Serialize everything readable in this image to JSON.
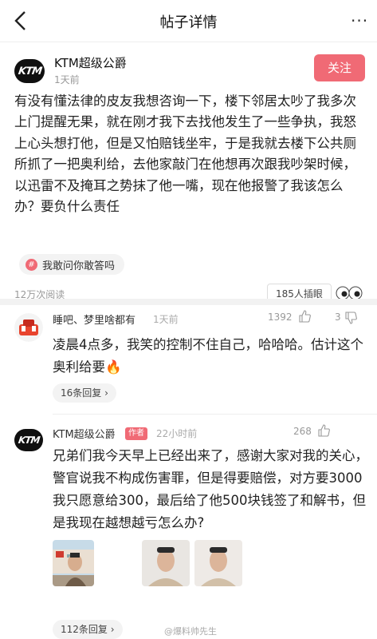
{
  "header": {
    "title": "帖子详情",
    "more_label": "···"
  },
  "post": {
    "author": "KTM超级公爵",
    "time": "1天前",
    "logo_text": "KTM",
    "follow_label": "关注",
    "body": "有没有懂法律的皮友我想咨询一下，楼下邻居太吵了我多次上门提醒无果，就在刚才我下去找他发生了一些争执，我怒上心头想打他，但是又怕赔钱坐牢，于是我就去楼下公共厕所抓了一把奥利给，去他家敲门在他想再次跟我吵架时候，以迅雷不及掩耳之势抹了他一嘴，现在他报警了我该怎么办？要负什么责任",
    "tag": "我敢问你敢答吗",
    "views": "12万次阅读",
    "pinyan": "185人插眼"
  },
  "comments": [
    {
      "author": "睡吧、梦里啥都有",
      "time": "1天前",
      "likes": "1392",
      "dislikes": "3",
      "text": "凌晨4点多，我笑的控制不住自己，哈哈哈。估计这个奥利给要🔥",
      "replies": "16条回复 ›"
    },
    {
      "author": "KTM超级公爵",
      "badge": "作者",
      "time": "22小时前",
      "likes": "268",
      "text": "兄弟们我今天早上已经出来了，感谢大家对我的关心，警官说我不构成伤害罪，但是得要赔偿，对方要3000我只愿意给300，最后给了他500块钱签了和解书，但是我现在越想越亏怎么办?",
      "replies": "112条回复 ›"
    }
  ],
  "watermark": "@爆料帅先生",
  "colors": {
    "accent": "#f06a75",
    "divider": "#eeeeee",
    "muted": "#999999"
  },
  "icons": [
    "back-arrow-icon",
    "more-icon",
    "thumbs-up-icon",
    "thumbs-down-icon",
    "fire-emoji",
    "eyes-emoji"
  ]
}
